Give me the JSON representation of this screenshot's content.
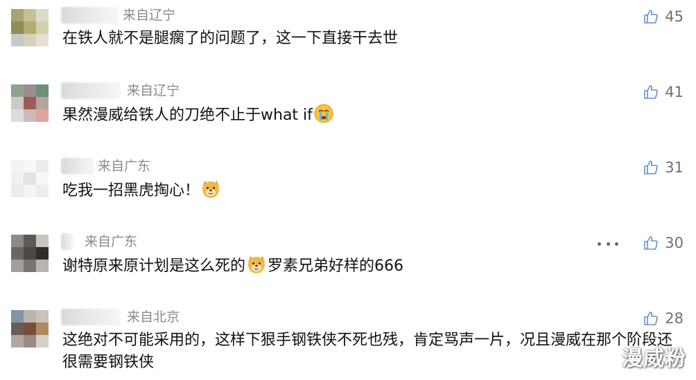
{
  "comments": [
    {
      "location": "来自辽宁",
      "text": "在铁人就不是腿瘸了的问题了，这一下直接干去世",
      "likes": "45",
      "avatar_colors": [
        "#a6a477",
        "#c5c197",
        "#dcdcc8",
        "#8f8e55",
        "#b3ad70",
        "#d2d0b0",
        "#c9c9c9",
        "#d6d2b8",
        "#e4e1d2"
      ]
    },
    {
      "location": "来自辽宁",
      "text_before": "果然漫威给铁人的刀绝不止于what if",
      "emoji": "crying-face-emoji",
      "likes": "41",
      "avatar_colors": [
        "#8ea38f",
        "#9a8e92",
        "#6f8f77",
        "#ccc9c7",
        "#9b5d55",
        "#b5a59f",
        "#dcdcdc",
        "#cdbab7",
        "#e0a3a0"
      ]
    },
    {
      "location": "来自广东",
      "text_before": "吃我一招黑虎掏心！",
      "emoji": "doge-emoji",
      "likes": "31",
      "avatar_colors": [
        "#f3f3f3",
        "#f8f8f8",
        "#ececec",
        "#f0f0f0",
        "#e4e4e4",
        "#f7f7f7",
        "#ebebeb",
        "#f5f5f5",
        "#eeeeee"
      ]
    },
    {
      "location": "来自广东",
      "text_before": "谢特原来原计划是这么死的",
      "emoji": "doge-emoji",
      "text_after": "罗素兄弟好样的666",
      "likes": "30",
      "avatar_colors": [
        "#8e8a85",
        "#5e5a55",
        "#c9c6c2",
        "#6b6660",
        "#4b4741",
        "#2f2d2a",
        "#a29f9a",
        "#7a756f",
        "#b8b5b0"
      ]
    },
    {
      "location": "来自北京",
      "text": "这绝对不可能采用的，这样下狠手钢铁侠不死也残，肯定骂声一片，况且漫威在那个阶段还很需要钢铁侠",
      "likes": "28",
      "avatar_colors": [
        "#8593a8",
        "#b9b6ae",
        "#c7c3bb",
        "#6b5c57",
        "#7a4e3a",
        "#ae8a63",
        "#b2a7a1",
        "#9a8c80",
        "#d4cfc8"
      ]
    }
  ],
  "more_icon": "more-dots-icon",
  "like_icon": "thumbs-up-icon",
  "watermark": "漫威粉"
}
